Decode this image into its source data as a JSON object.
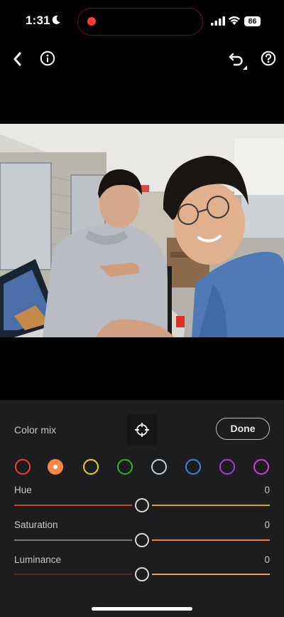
{
  "status": {
    "time": "1:31",
    "battery": "86",
    "moon_icon": "moon-icon",
    "signal_icon": "cellular-signal-icon",
    "wifi_icon": "wifi-icon"
  },
  "toolbar": {
    "back_icon": "chevron-left-icon",
    "info_icon": "info-icon",
    "undo_icon": "undo-icon",
    "help_icon": "help-icon"
  },
  "panel": {
    "title": "Color mix",
    "target_icon": "target-adjust-icon",
    "done_label": "Done",
    "swatches": [
      {
        "name": "red",
        "color": "#e8413b",
        "selected": false
      },
      {
        "name": "orange",
        "color": "#f08a46",
        "selected": true
      },
      {
        "name": "yellow",
        "color": "#e4d22a",
        "selected": false
      },
      {
        "name": "green",
        "color": "#2fb22f",
        "selected": false
      },
      {
        "name": "aqua",
        "color": "#b7d3e3",
        "selected": false
      },
      {
        "name": "blue",
        "color": "#4b7fd8",
        "selected": false
      },
      {
        "name": "purple",
        "color": "#9b3fd6",
        "selected": false
      },
      {
        "name": "magenta",
        "color": "#d13fd3",
        "selected": false
      }
    ],
    "sliders": [
      {
        "label": "Hue",
        "value": "0",
        "colors": [
          "#c9402f",
          "#d6a423"
        ]
      },
      {
        "label": "Saturation",
        "value": "0",
        "colors": [
          "#7a7a7a",
          "#e0823b"
        ]
      },
      {
        "label": "Luminance",
        "value": "0",
        "colors": [
          "#4a2e20",
          "#e5a470"
        ]
      }
    ]
  }
}
